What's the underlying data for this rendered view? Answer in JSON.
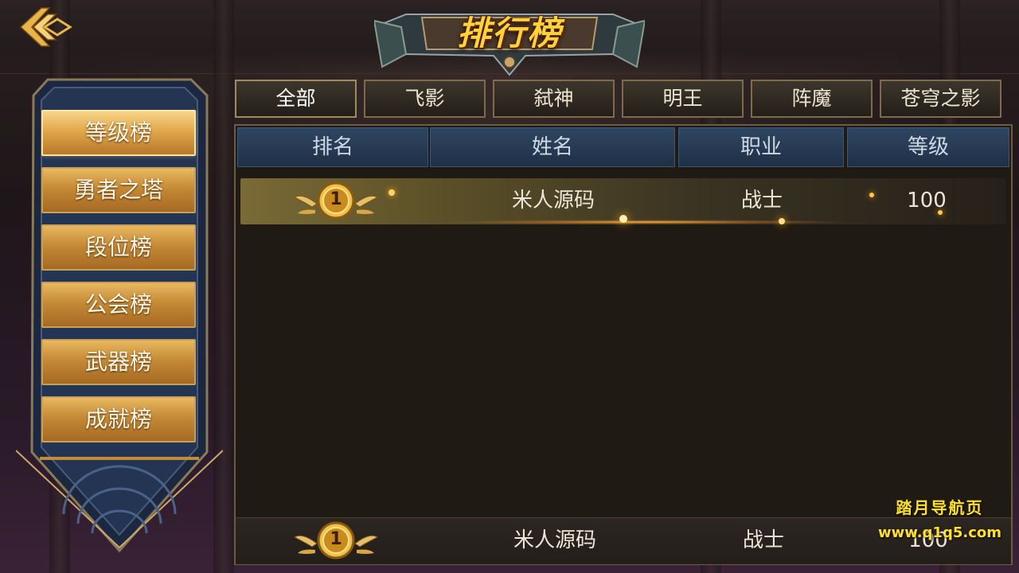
{
  "title": "排行榜",
  "categories": [
    {
      "label": "等级榜",
      "active": true
    },
    {
      "label": "勇者之塔",
      "active": false
    },
    {
      "label": "段位榜",
      "active": false
    },
    {
      "label": "公会榜",
      "active": false
    },
    {
      "label": "武器榜",
      "active": false
    },
    {
      "label": "成就榜",
      "active": false
    }
  ],
  "tabs": [
    {
      "label": "全部",
      "active": true
    },
    {
      "label": "飞影",
      "active": false
    },
    {
      "label": "弑神",
      "active": false
    },
    {
      "label": "明王",
      "active": false
    },
    {
      "label": "阵魔",
      "active": false
    },
    {
      "label": "苍穹之影",
      "active": false
    }
  ],
  "table": {
    "columns": [
      "排名",
      "姓名",
      "职业",
      "等级"
    ],
    "rows": [
      {
        "rank": "1",
        "name": "米人源码",
        "class": "战士",
        "level": "100"
      }
    ]
  },
  "my_rank": {
    "rank": "1",
    "name": "米人源码",
    "class": "战士",
    "level": "100"
  },
  "watermark": {
    "title": "踏月导航页",
    "url": "www.q1q5.com"
  },
  "colors": {
    "gold": "#ffd23a",
    "header_blue": "#2f4661",
    "button_gold": "#c58a36"
  }
}
